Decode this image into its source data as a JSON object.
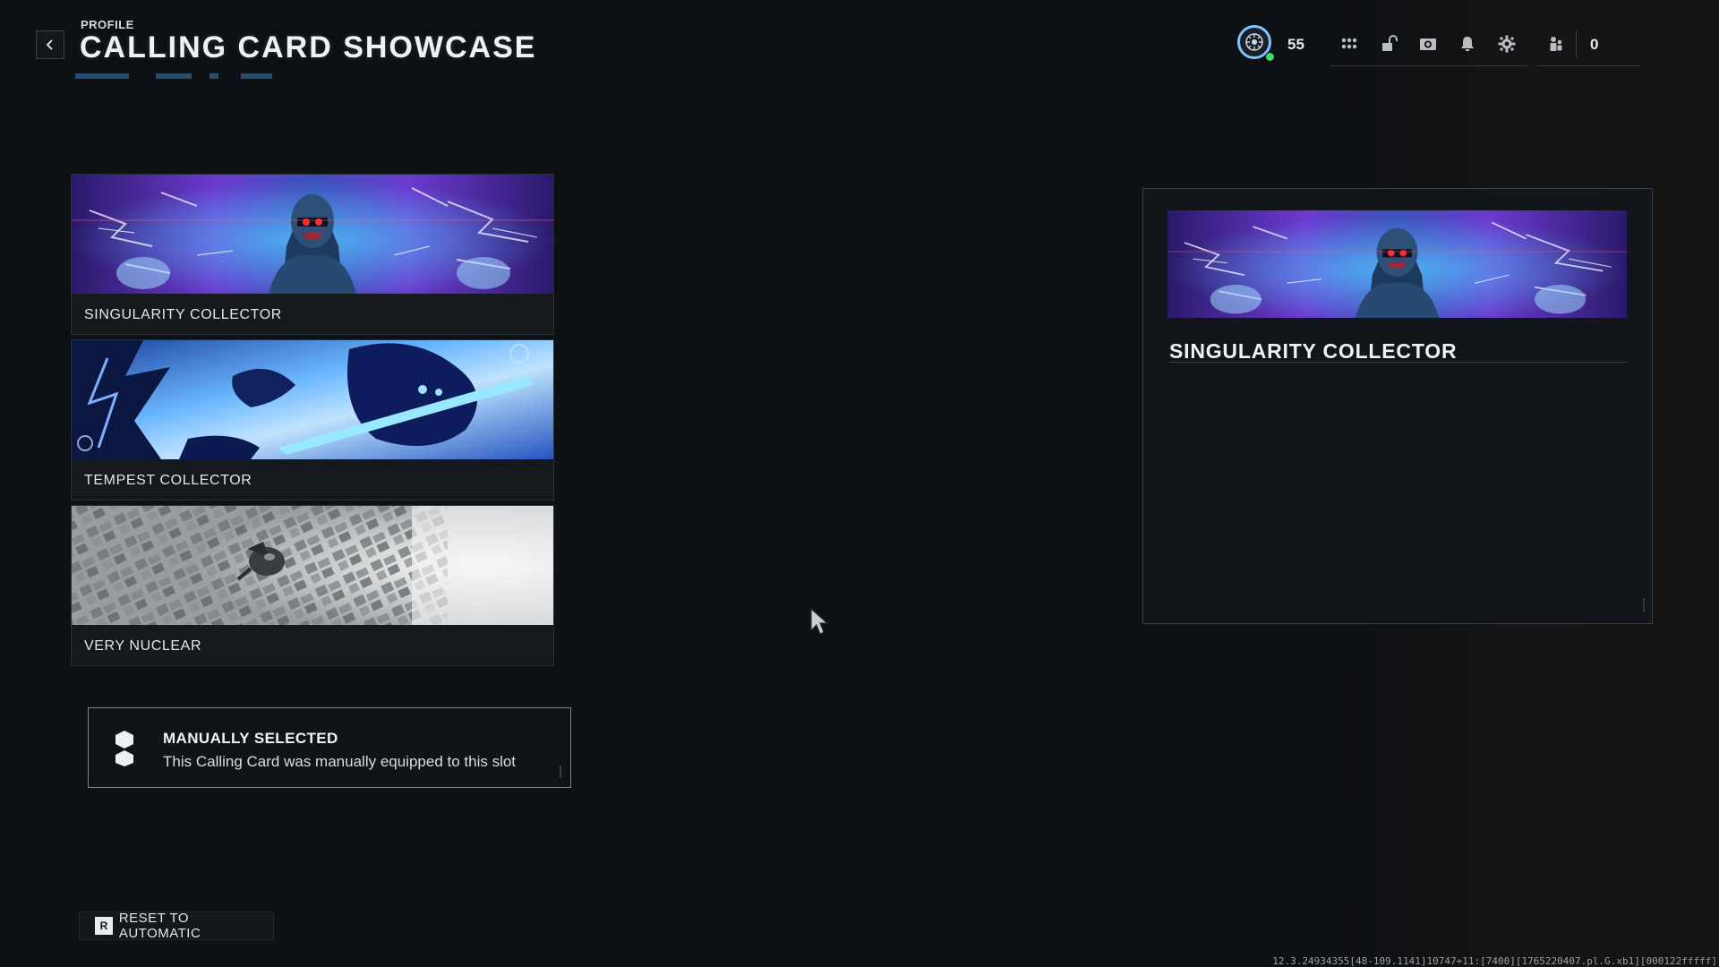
{
  "header": {
    "breadcrumb": "PROFILE",
    "title": "CALLING CARD SHOWCASE"
  },
  "topbar": {
    "level": "55",
    "friends_count": "0",
    "icons": [
      "grid-menu-icon",
      "unlock-icon",
      "screenshot-icon",
      "bell-icon",
      "gear-icon",
      "friends-icon"
    ]
  },
  "cards": [
    {
      "label": "SINGULARITY COLLECTOR"
    },
    {
      "label": "TEMPEST COLLECTOR"
    },
    {
      "label": "VERY NUCLEAR"
    }
  ],
  "info": {
    "title": "MANUALLY SELECTED",
    "description": "This Calling Card was manually equipped to this slot"
  },
  "reset": {
    "key": "R",
    "label": "RESET TO AUTOMATIC"
  },
  "preview": {
    "title": "SINGULARITY COLLECTOR"
  },
  "build_string": "12.3.24934355[48-109.1141]10747+11:[7400][1765220407.pl.G.xb1][000122fffff]",
  "colors": {
    "background": "#0d1014",
    "accent_blue": "#7fc3ff",
    "online_green": "#3ddc6a"
  }
}
